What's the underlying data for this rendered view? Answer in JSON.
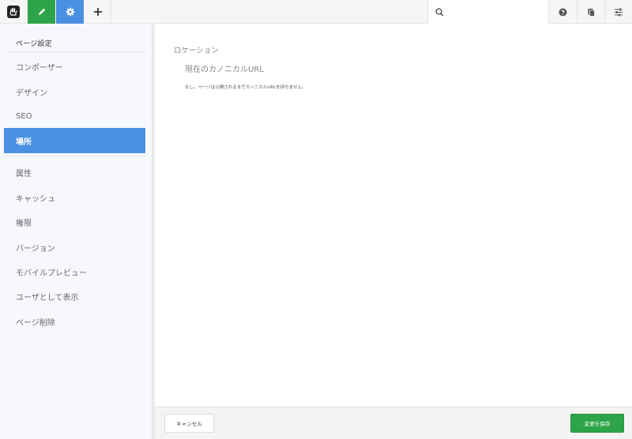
{
  "toolbar": {
    "logo_icon": "concrete-logo-icon",
    "edit_icon": "pencil-icon",
    "settings_icon": "gear-icon",
    "add_icon": "plus-icon",
    "search_icon": "search-icon",
    "search_value": "",
    "help_icon": "question-circle-icon",
    "pages_icon": "copy-pages-icon",
    "panels_icon": "sliders-icon",
    "colors": {
      "edit": "#2ea44a",
      "settings": "#4a90e2"
    }
  },
  "sidebar": {
    "title": "ページ設定",
    "items": [
      {
        "label": "コンポーザー"
      },
      {
        "label": "デザイン"
      },
      {
        "label": "SEO"
      },
      {
        "label": "場所",
        "active": true
      },
      {
        "label": "属性"
      },
      {
        "label": "キャッシュ"
      },
      {
        "label": "権限"
      },
      {
        "label": "バージョン"
      },
      {
        "label": "モバイルプレビュー"
      },
      {
        "label": "ユーザとして表示"
      },
      {
        "label": "ページ削除"
      }
    ]
  },
  "main": {
    "section_title": "ロケーション",
    "field_label": "現在のカノニカルURL",
    "field_note": "なし。ページは公開されるまでカノニカルURLを持ちません。"
  },
  "footer": {
    "cancel_label": "キャンセル",
    "save_label": "変更を保存",
    "save_color": "#2ea44a"
  }
}
